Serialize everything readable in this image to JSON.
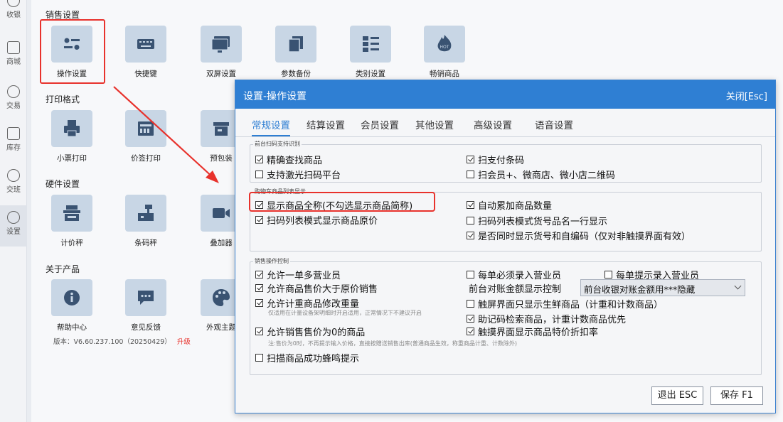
{
  "nav": [
    {
      "label": "收银"
    },
    {
      "label": "商城"
    },
    {
      "label": "交易"
    },
    {
      "label": "库存"
    },
    {
      "label": "交班"
    },
    {
      "label": "设置"
    }
  ],
  "sections": {
    "sales": "销售设置",
    "print": "打印格式",
    "hardware": "硬件设置",
    "about": "关于产品"
  },
  "tiles": {
    "op_settings": "操作设置",
    "shortcut": "快捷键",
    "dual_screen": "双屏设置",
    "param_backup": "参数备份",
    "category": "类别设置",
    "bestseller": "畅销商品",
    "hot_badge": "HOT",
    "receipt_print": "小票打印",
    "label_print": "价签打印",
    "prepack": "预包装",
    "scale": "计价秤",
    "barcode_scale": "条码秤",
    "overlay": "叠加器",
    "help": "帮助中心",
    "feedback": "意见反馈",
    "theme": "外观主题"
  },
  "version": {
    "text": "版本：V6.60.237.100（20250429）",
    "upgrade": "升级"
  },
  "dialog": {
    "title": "设置-操作设置",
    "close": "关闭[Esc]",
    "tabs": [
      "常规设置",
      "结算设置",
      "会员设置",
      "其他设置",
      "高级设置",
      "语音设置"
    ],
    "groups": {
      "scan": {
        "legend": "前台扫码支持识别",
        "options": [
          {
            "label": "精确查找商品",
            "checked": true
          },
          {
            "label": "扫支付条码",
            "checked": true
          },
          {
            "label": "支持激光扫码平台",
            "checked": false
          },
          {
            "label": "扫会员+、微商店、微小店二维码",
            "checked": false
          }
        ]
      },
      "cart": {
        "legend": "购物车商品列表显示",
        "options": [
          {
            "label": "显示商品全称(不勾选显示商品简称)",
            "checked": true
          },
          {
            "label": "自动累加商品数量",
            "checked": true
          },
          {
            "label": "扫码列表模式显示商品原价",
            "checked": true
          },
          {
            "label": "扫码列表模式货号品名一行显示",
            "checked": false
          },
          {
            "label": "是否同时显示货号和自编码（仅对非触摸界面有效）",
            "checked": true
          }
        ]
      },
      "sales": {
        "legend": "销售操作控制",
        "options": [
          {
            "label": "允许一单多营业员",
            "checked": true
          },
          {
            "label": "每单必须录入营业员",
            "checked": false
          },
          {
            "label": "每单提示录入营业员",
            "checked": false
          },
          {
            "label": "允许商品售价大于原价销售",
            "checked": true
          },
          {
            "label": "允许计重商品修改重量",
            "checked": true
          },
          {
            "label": "触屏界面只显示生鲜商品（计重和计数商品）",
            "checked": false
          },
          {
            "label": "助记码检索商品，计重计数商品优先",
            "checked": true
          },
          {
            "label": "允许销售售价为0的商品",
            "checked": true
          },
          {
            "label": "触摸界面显示商品特价折扣率",
            "checked": true
          },
          {
            "label": "扫描商品成功蜂鸣提示",
            "checked": false
          }
        ],
        "reconcile_label": "前台对账金额显示控制",
        "reconcile_value": "前台收银对账金额用***隐藏",
        "hint_weight": "仅适用在计量设备架明细时开启适用，正常情况下不建议开启",
        "hint_zero": "注:售价为0时，不再提示输入价格，直接按赠送销售出库(普通商品生效，称重商品计重、计数除外)"
      }
    },
    "buttons": {
      "exit": "退出 ESC",
      "save": "保存 F1"
    }
  },
  "colors": {
    "accent": "#2f7fd3",
    "highlight": "#e8322c",
    "tile_bg": "#c8d6e5",
    "icon_dark": "#3a5372"
  }
}
